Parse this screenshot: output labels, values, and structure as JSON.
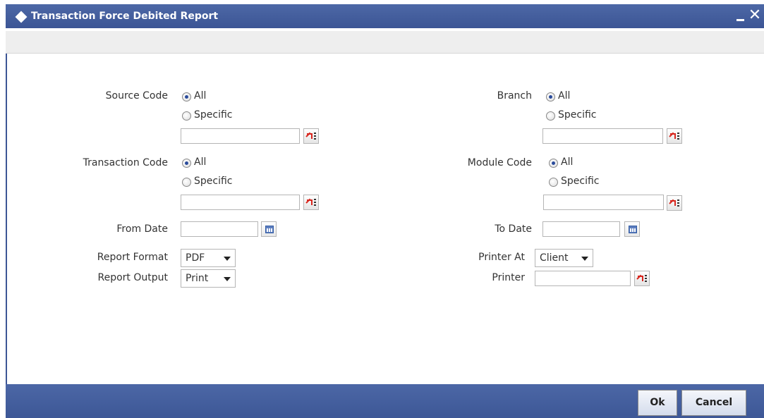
{
  "window": {
    "title": "Transaction Force Debited Report",
    "minimize": "_",
    "close": "✕"
  },
  "source_code": {
    "label": "Source Code",
    "all": "All",
    "specific": "Specific",
    "selected": "All",
    "value": ""
  },
  "transaction_code": {
    "label": "Transaction Code",
    "all": "All",
    "specific": "Specific",
    "selected": "All",
    "value": ""
  },
  "branch": {
    "label": "Branch",
    "all": "All",
    "specific": "Specific",
    "selected": "All",
    "value": ""
  },
  "module_code": {
    "label": "Module Code",
    "all": "All",
    "specific": "Specific",
    "selected": "All",
    "value": ""
  },
  "from_date": {
    "label": "From Date",
    "value": ""
  },
  "to_date": {
    "label": "To Date",
    "value": ""
  },
  "report_format": {
    "label": "Report Format",
    "value": "PDF"
  },
  "report_output": {
    "label": "Report Output",
    "value": "Print"
  },
  "printer_at": {
    "label": "Printer At",
    "value": "Client"
  },
  "printer": {
    "label": "Printer",
    "value": ""
  },
  "footer": {
    "ok": "Ok",
    "cancel": "Cancel"
  },
  "colors": {
    "titlebar": "#3c5595",
    "footer": "#4460a0",
    "radio_selected": "#2a4b9b"
  },
  "icons": {
    "lov": "lov-icon",
    "calendar": "calendar-icon",
    "title": "diamond-icon"
  }
}
